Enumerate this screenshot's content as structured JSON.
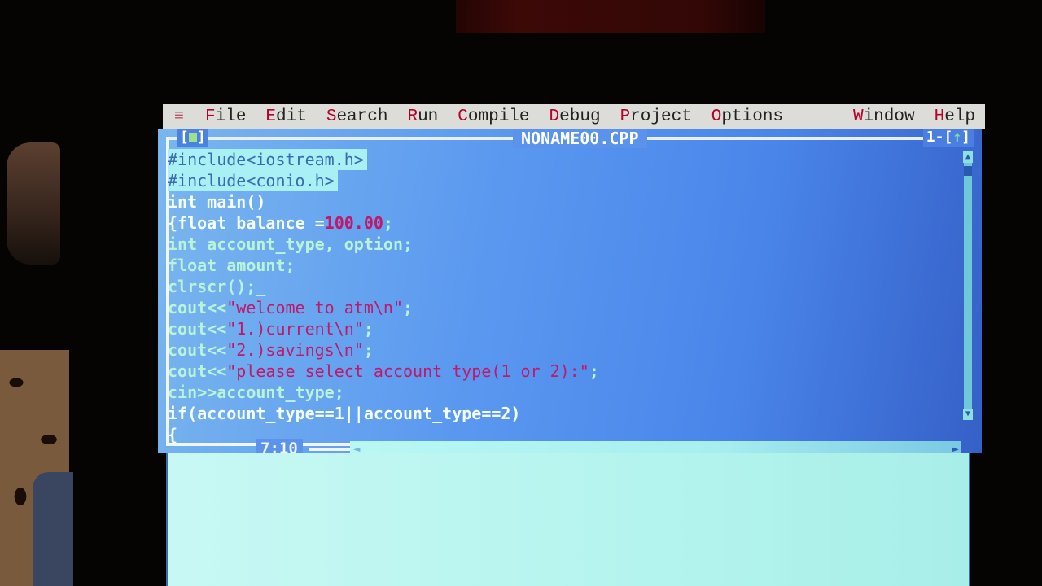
{
  "menubar": {
    "system_icon": "≡",
    "items": [
      {
        "hot": "F",
        "rest": "ile",
        "label": "File"
      },
      {
        "hot": "E",
        "rest": "dit",
        "label": "Edit"
      },
      {
        "hot": "S",
        "rest": "earch",
        "label": "Search"
      },
      {
        "hot": "R",
        "rest": "un",
        "label": "Run"
      },
      {
        "hot": "C",
        "rest": "ompile",
        "label": "Compile"
      },
      {
        "hot": "D",
        "rest": "ebug",
        "label": "Debug"
      },
      {
        "hot": "P",
        "rest": "roject",
        "label": "Project"
      },
      {
        "hot": "O",
        "rest": "ptions",
        "label": "Options"
      },
      {
        "hot": "W",
        "rest": "indow",
        "label": "Window"
      },
      {
        "hot": "H",
        "rest": "elp",
        "label": "Help"
      }
    ]
  },
  "editor": {
    "close_box": "[■]",
    "close_open": "[",
    "close_close": "]",
    "title": "NONAME00.CPP",
    "window_number": "1",
    "zoom_open": "-[",
    "zoom_arrow": "↑",
    "zoom_close": "]",
    "cursor_position": "7:10",
    "lines": {
      "l1": "#include<iostream.h>",
      "l2": "#include<conio.h>",
      "l3": "int main()",
      "l4a": "{float balance =",
      "l4b": "100.00",
      "l4c": ";",
      "l5": "int account_type, option;",
      "l6": "float amount;",
      "l7": "clrscr();_",
      "l8a": "cout<<",
      "l8b": "\"welcome to atm\\n\"",
      "l8c": ";",
      "l9a": "cout<<",
      "l9b": "\"1.)current\\n\"",
      "l9c": ";",
      "l10a": "cout<<",
      "l10b": "\"2.)savings\\n\"",
      "l10c": ";",
      "l11a": "cout<<",
      "l11b": "\"please select account type(1 or 2):\"",
      "l11c": ";",
      "l12": "cin>>account_type;",
      "l13": "if(account_type==1||account_type==2)",
      "l14": "{"
    }
  },
  "scroll": {
    "up_arrow": "▲",
    "down_arrow": "▼",
    "left_arrow": "◄",
    "right_arrow": "►"
  },
  "colors": {
    "editor_bg": "#5a98f0",
    "menubar_bg": "#dcdcd8",
    "menu_hotkey": "#b8002a",
    "string_literal": "#c0186a",
    "selection_bg": "#a8f0f4",
    "message_bg": "#b4f4ee"
  }
}
